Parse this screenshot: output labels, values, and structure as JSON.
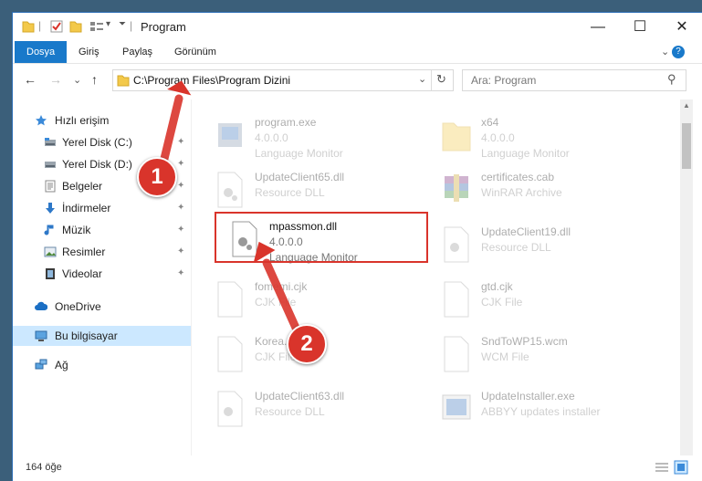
{
  "window": {
    "title": "Program",
    "controls": {
      "minimize": "—",
      "maximize": "☐",
      "close": "✕"
    }
  },
  "ribbon": {
    "tabs": [
      "Dosya",
      "Giriş",
      "Paylaş",
      "Görünüm"
    ],
    "expand": "⌄",
    "help": "?"
  },
  "nav": {
    "back": "←",
    "forward": "→",
    "recent": "⌄",
    "up": "↑",
    "address": "C:\\Program Files\\Program Dizini",
    "address_dropdown": "⌄",
    "refresh": "↻",
    "search_placeholder": "Ara: Program",
    "search_icon": "⚲"
  },
  "sidebar": {
    "items": [
      {
        "label": "Hızlı erişim",
        "icon": "star-icon",
        "pinned": false
      },
      {
        "label": "Yerel Disk (C:)",
        "icon": "drive-icon",
        "pinned": true
      },
      {
        "label": "Yerel Disk (D:)",
        "icon": "drive-icon",
        "pinned": true
      },
      {
        "label": "Belgeler",
        "icon": "documents-icon",
        "pinned": true
      },
      {
        "label": "İndirmeler",
        "icon": "download-icon",
        "pinned": true
      },
      {
        "label": "Müzik",
        "icon": "music-icon",
        "pinned": true
      },
      {
        "label": "Resimler",
        "icon": "pictures-icon",
        "pinned": true
      },
      {
        "label": "Videolar",
        "icon": "video-icon",
        "pinned": true
      },
      {
        "label": "OneDrive",
        "icon": "cloud-icon",
        "pinned": false
      },
      {
        "label": "Bu bilgisayar",
        "icon": "computer-icon",
        "pinned": false,
        "selected": true
      },
      {
        "label": "Ağ",
        "icon": "network-icon",
        "pinned": false
      }
    ],
    "pin_glyph": "📌"
  },
  "files": [
    {
      "name": "program.exe",
      "version": "4.0.0.0",
      "desc": "Language Monitor",
      "type": "exe"
    },
    {
      "name": "x64",
      "version": "4.0.0.0",
      "desc": "Language Monitor",
      "type": "folder"
    },
    {
      "name": "UpdateClient65.dll",
      "version": "",
      "desc": "Resource DLL",
      "type": "dll"
    },
    {
      "name": "certificates.cab",
      "version": "",
      "desc": "WinRAR Archive",
      "type": "archive"
    },
    {
      "name": "mpassmon.dll",
      "version": "4.0.0.0",
      "desc": "Language Monitor",
      "type": "dll",
      "highlighted": true
    },
    {
      "name": "UpdateClient19.dll",
      "version": "",
      "desc": "Resource DLL",
      "type": "dll"
    },
    {
      "name": "fomemi.cjk",
      "version": "",
      "desc": "CJK File",
      "type": "file"
    },
    {
      "name": "gtd.cjk",
      "version": "",
      "desc": "CJK File",
      "type": "file"
    },
    {
      "name": "Korea.cjk",
      "version": "",
      "desc": "CJK File",
      "type": "file"
    },
    {
      "name": "SndToWP15.wcm",
      "version": "",
      "desc": "WCM File",
      "type": "file"
    },
    {
      "name": "UpdateClient63.dll",
      "version": "",
      "desc": "Resource DLL",
      "type": "dll"
    },
    {
      "name": "UpdateInstaller.exe",
      "version": "",
      "desc": "ABBYY updates installer",
      "type": "app"
    }
  ],
  "status": {
    "count": "164 öğe"
  },
  "annotations": {
    "callout1": "1",
    "callout2": "2"
  },
  "colors": {
    "accent": "#1979ca",
    "highlight": "#d9342b",
    "selection": "#cce8ff"
  }
}
